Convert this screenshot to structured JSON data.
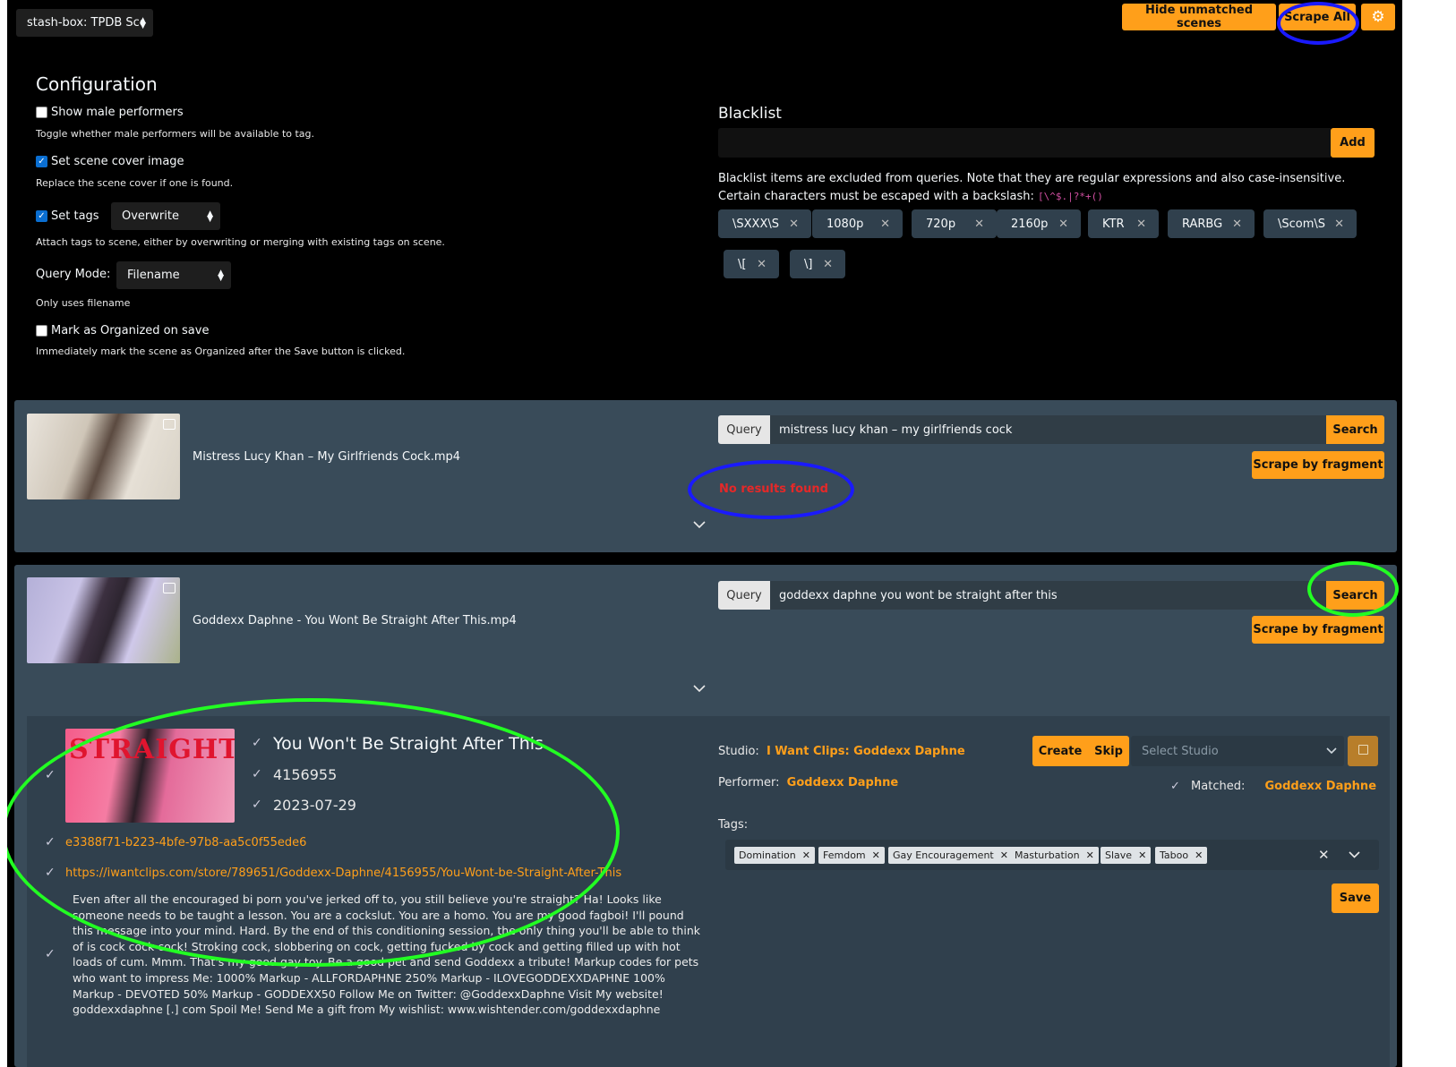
{
  "header": {
    "source_select": "stash-box: TPDB Scene",
    "hide_unmatched": "Hide unmatched scenes",
    "scrape_all": "Scrape All",
    "gear_icon": "gear-icon"
  },
  "config": {
    "title": "Configuration",
    "show_male": {
      "label": "Show male performers",
      "checked": false,
      "help": "Toggle whether male performers will be available to tag."
    },
    "set_cover": {
      "label": "Set scene cover image",
      "checked": true,
      "help": "Replace the scene cover if one is found."
    },
    "set_tags": {
      "label": "Set tags",
      "checked": true,
      "mode": "Overwrite",
      "help": "Attach tags to scene, either by overwriting or merging with existing tags on scene."
    },
    "query_mode": {
      "label": "Query Mode:",
      "value": "Filename",
      "help": "Only uses filename"
    },
    "mark_organized": {
      "label": "Mark as Organized on save",
      "checked": false,
      "help": "Immediately mark the scene as Organized after the Save button is clicked."
    }
  },
  "blacklist": {
    "title": "Blacklist",
    "add": "Add",
    "help": "Blacklist items are excluded from queries. Note that they are regular expressions and also case-insensitive. Certain characters must be escaped with a backslash:",
    "help_code": "[\\^$.|?*+()",
    "items": [
      "\\SXXX\\S",
      "1080p",
      "720p",
      "2160p",
      "KTR",
      "RARBG",
      "\\Scom\\S",
      "\\[",
      "\\]"
    ]
  },
  "scene1": {
    "filename": "Mistress Lucy Khan – My Girlfriends Cock.mp4",
    "query_label": "Query",
    "query": "mistress lucy khan – my girlfriends cock",
    "search": "Search",
    "scrape_fragment": "Scrape by fragment",
    "no_results": "No results found"
  },
  "scene2": {
    "filename": "Goddexx Daphne - You Wont Be Straight After This.mp4",
    "query_label": "Query",
    "query": "goddexx daphne you wont be straight after this",
    "search": "Search",
    "scrape_fragment": "Scrape by fragment"
  },
  "result": {
    "title": "You Won't Be Straight After This",
    "code": "4156955",
    "date": "2023-07-29",
    "id": "e3388f71-b223-4bfe-97b8-aa5c0f55ede6",
    "url": "https://iwantclips.com/store/789651/Goddexx-Daphne/4156955/You-Wont-be-Straight-After-This",
    "description": "Even after all the encouraged bi porn you've jerked off to, you still believe you're straight? Ha! Looks like someone needs to be taught a lesson. You are a cockslut. You are a homo. You are my good fagboi! I'll pound this message into your mind. Hard. By the end of this conditioning session, the only thing you'll be able to think of is cock cock cock! Stroking cock, slobbering on cock, getting fucked by cock and getting filled up with hot loads of cum. Mmm. That's my good gay toy. Be a good pet and send Goddexx a tribute! Markup codes for pets who want to impress Me: 1000% Markup - ALLFORDAPHNE 250% Markup - ILOVEGODDEXXDAPHNE 100% Markup - DEVOTED 50% Markup - GODDEXX50 Follow Me on Twitter: @GoddexxDaphne Visit My website! goddexxdaphne [.] com Spoil Me! Send Me a gift from My wishlist: www.wishtender.com/goddexxdaphne",
    "studio_label": "Studio:",
    "studio": "I Want Clips: Goddexx Daphne",
    "create": "Create",
    "skip": "Skip",
    "studio_placeholder": "Select Studio",
    "performer_label": "Performer:",
    "performer": "Goddexx Daphne",
    "matched_label": "Matched:",
    "matched": "Goddexx Daphne",
    "tags_label": "Tags:",
    "tags": [
      "Domination",
      "Femdom",
      "Gay Encouragement",
      "Masturbation",
      "Slave",
      "Taboo"
    ],
    "save": "Save"
  },
  "colors": {
    "accent": "#ff9f1a",
    "card": "#394b59",
    "panel": "#30404d",
    "annotation_blue": "#1a1aff",
    "annotation_green": "#22ff22"
  }
}
